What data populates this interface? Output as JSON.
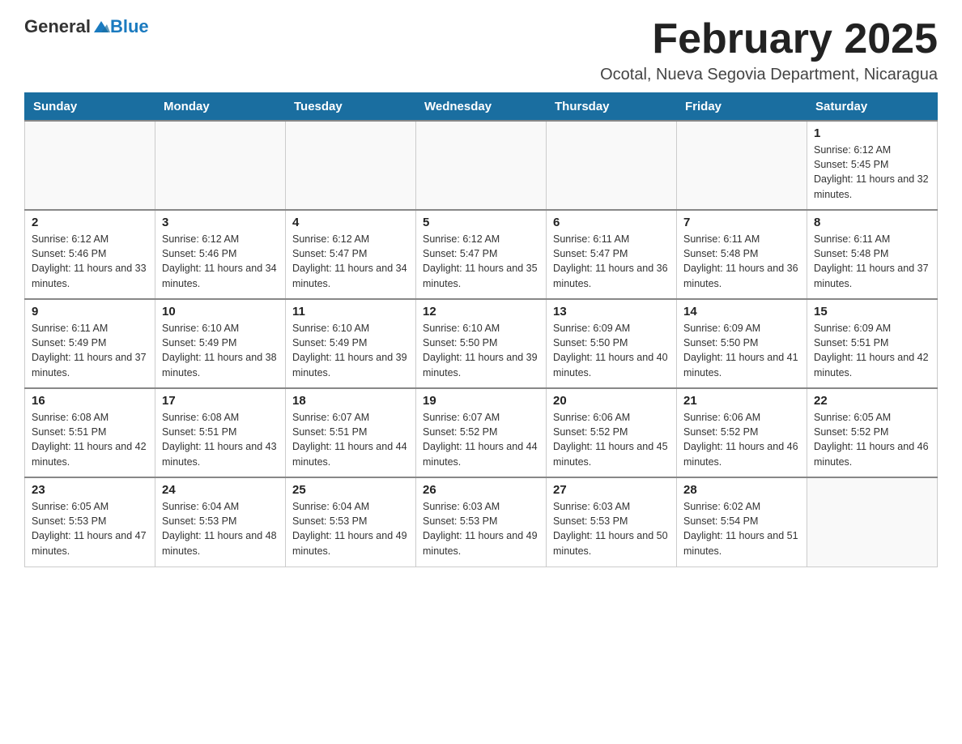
{
  "header": {
    "logo_general": "General",
    "logo_blue": "Blue",
    "month_title": "February 2025",
    "subtitle": "Ocotal, Nueva Segovia Department, Nicaragua"
  },
  "weekdays": [
    "Sunday",
    "Monday",
    "Tuesday",
    "Wednesday",
    "Thursday",
    "Friday",
    "Saturday"
  ],
  "weeks": [
    [
      {
        "day": "",
        "info": ""
      },
      {
        "day": "",
        "info": ""
      },
      {
        "day": "",
        "info": ""
      },
      {
        "day": "",
        "info": ""
      },
      {
        "day": "",
        "info": ""
      },
      {
        "day": "",
        "info": ""
      },
      {
        "day": "1",
        "info": "Sunrise: 6:12 AM\nSunset: 5:45 PM\nDaylight: 11 hours and 32 minutes."
      }
    ],
    [
      {
        "day": "2",
        "info": "Sunrise: 6:12 AM\nSunset: 5:46 PM\nDaylight: 11 hours and 33 minutes."
      },
      {
        "day": "3",
        "info": "Sunrise: 6:12 AM\nSunset: 5:46 PM\nDaylight: 11 hours and 34 minutes."
      },
      {
        "day": "4",
        "info": "Sunrise: 6:12 AM\nSunset: 5:47 PM\nDaylight: 11 hours and 34 minutes."
      },
      {
        "day": "5",
        "info": "Sunrise: 6:12 AM\nSunset: 5:47 PM\nDaylight: 11 hours and 35 minutes."
      },
      {
        "day": "6",
        "info": "Sunrise: 6:11 AM\nSunset: 5:47 PM\nDaylight: 11 hours and 36 minutes."
      },
      {
        "day": "7",
        "info": "Sunrise: 6:11 AM\nSunset: 5:48 PM\nDaylight: 11 hours and 36 minutes."
      },
      {
        "day": "8",
        "info": "Sunrise: 6:11 AM\nSunset: 5:48 PM\nDaylight: 11 hours and 37 minutes."
      }
    ],
    [
      {
        "day": "9",
        "info": "Sunrise: 6:11 AM\nSunset: 5:49 PM\nDaylight: 11 hours and 37 minutes."
      },
      {
        "day": "10",
        "info": "Sunrise: 6:10 AM\nSunset: 5:49 PM\nDaylight: 11 hours and 38 minutes."
      },
      {
        "day": "11",
        "info": "Sunrise: 6:10 AM\nSunset: 5:49 PM\nDaylight: 11 hours and 39 minutes."
      },
      {
        "day": "12",
        "info": "Sunrise: 6:10 AM\nSunset: 5:50 PM\nDaylight: 11 hours and 39 minutes."
      },
      {
        "day": "13",
        "info": "Sunrise: 6:09 AM\nSunset: 5:50 PM\nDaylight: 11 hours and 40 minutes."
      },
      {
        "day": "14",
        "info": "Sunrise: 6:09 AM\nSunset: 5:50 PM\nDaylight: 11 hours and 41 minutes."
      },
      {
        "day": "15",
        "info": "Sunrise: 6:09 AM\nSunset: 5:51 PM\nDaylight: 11 hours and 42 minutes."
      }
    ],
    [
      {
        "day": "16",
        "info": "Sunrise: 6:08 AM\nSunset: 5:51 PM\nDaylight: 11 hours and 42 minutes."
      },
      {
        "day": "17",
        "info": "Sunrise: 6:08 AM\nSunset: 5:51 PM\nDaylight: 11 hours and 43 minutes."
      },
      {
        "day": "18",
        "info": "Sunrise: 6:07 AM\nSunset: 5:51 PM\nDaylight: 11 hours and 44 minutes."
      },
      {
        "day": "19",
        "info": "Sunrise: 6:07 AM\nSunset: 5:52 PM\nDaylight: 11 hours and 44 minutes."
      },
      {
        "day": "20",
        "info": "Sunrise: 6:06 AM\nSunset: 5:52 PM\nDaylight: 11 hours and 45 minutes."
      },
      {
        "day": "21",
        "info": "Sunrise: 6:06 AM\nSunset: 5:52 PM\nDaylight: 11 hours and 46 minutes."
      },
      {
        "day": "22",
        "info": "Sunrise: 6:05 AM\nSunset: 5:52 PM\nDaylight: 11 hours and 46 minutes."
      }
    ],
    [
      {
        "day": "23",
        "info": "Sunrise: 6:05 AM\nSunset: 5:53 PM\nDaylight: 11 hours and 47 minutes."
      },
      {
        "day": "24",
        "info": "Sunrise: 6:04 AM\nSunset: 5:53 PM\nDaylight: 11 hours and 48 minutes."
      },
      {
        "day": "25",
        "info": "Sunrise: 6:04 AM\nSunset: 5:53 PM\nDaylight: 11 hours and 49 minutes."
      },
      {
        "day": "26",
        "info": "Sunrise: 6:03 AM\nSunset: 5:53 PM\nDaylight: 11 hours and 49 minutes."
      },
      {
        "day": "27",
        "info": "Sunrise: 6:03 AM\nSunset: 5:53 PM\nDaylight: 11 hours and 50 minutes."
      },
      {
        "day": "28",
        "info": "Sunrise: 6:02 AM\nSunset: 5:54 PM\nDaylight: 11 hours and 51 minutes."
      },
      {
        "day": "",
        "info": ""
      }
    ]
  ]
}
